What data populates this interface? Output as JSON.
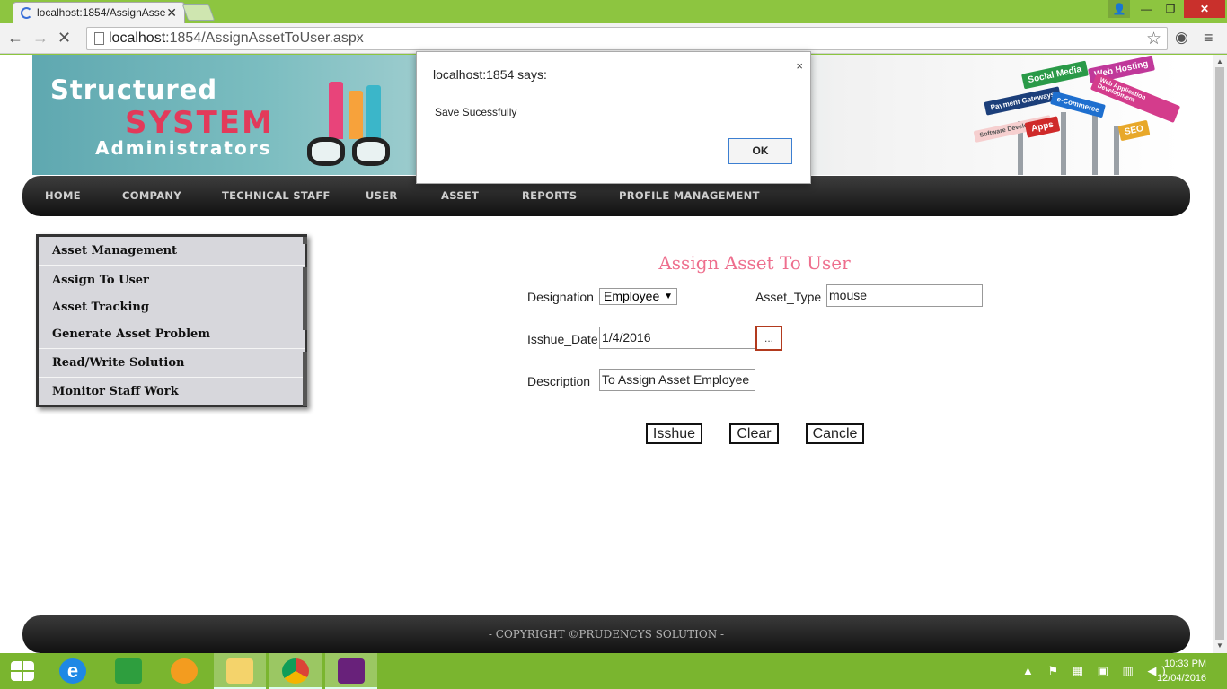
{
  "browser": {
    "tab_title": "localhost:1854/AssignAsse",
    "url_host": "localhost",
    "url_rest": ":1854/AssignAssetToUser.aspx"
  },
  "banner": {
    "line1": "Structured",
    "line2": "SYSTEM",
    "line3": "Administrators",
    "signs": [
      "Web Hosting",
      "Social Media",
      "Payment Gateways",
      "Web Application Development",
      "e-Commerce",
      "Software Development",
      "Apps",
      "SEO"
    ]
  },
  "nav": {
    "items": [
      "HOME",
      "COMPANY",
      "TECHNICAL STAFF",
      "USER",
      "ASSET",
      "REPORTS",
      "PROFILE MANAGEMENT"
    ]
  },
  "sidemenu": {
    "items": [
      "Asset Management",
      "Assign To User",
      "Asset Tracking",
      "Generate Asset Problem",
      "Read/Write Solution",
      "Monitor Staff Work"
    ]
  },
  "form": {
    "title": "Assign Asset To User",
    "designation_label": "Designation",
    "designation_value": "Employee",
    "asset_type_label": "Asset_Type",
    "asset_type_value": "mouse",
    "issue_date_label": "Isshue_Date",
    "issue_date_value": "1/4/2016",
    "calendar_button": "...",
    "description_label": "Description",
    "description_value": "To Assign Asset Employee",
    "buttons": {
      "issue": "Isshue",
      "clear": "Clear",
      "cancel": "Cancle"
    }
  },
  "footer": {
    "copyright": "- COPYRIGHT ©PRUDENCYS SOLUTION -"
  },
  "dialog": {
    "title": "localhost:1854 says:",
    "message": "Save Sucessfully",
    "ok": "OK",
    "close": "×"
  },
  "taskbar": {
    "time": "10:33 PM",
    "date": "12/04/2016"
  },
  "colors": {
    "accent_green": "#8dc540",
    "form_title": "#ee6f8e",
    "nav_bg": "#1a1a1a"
  }
}
